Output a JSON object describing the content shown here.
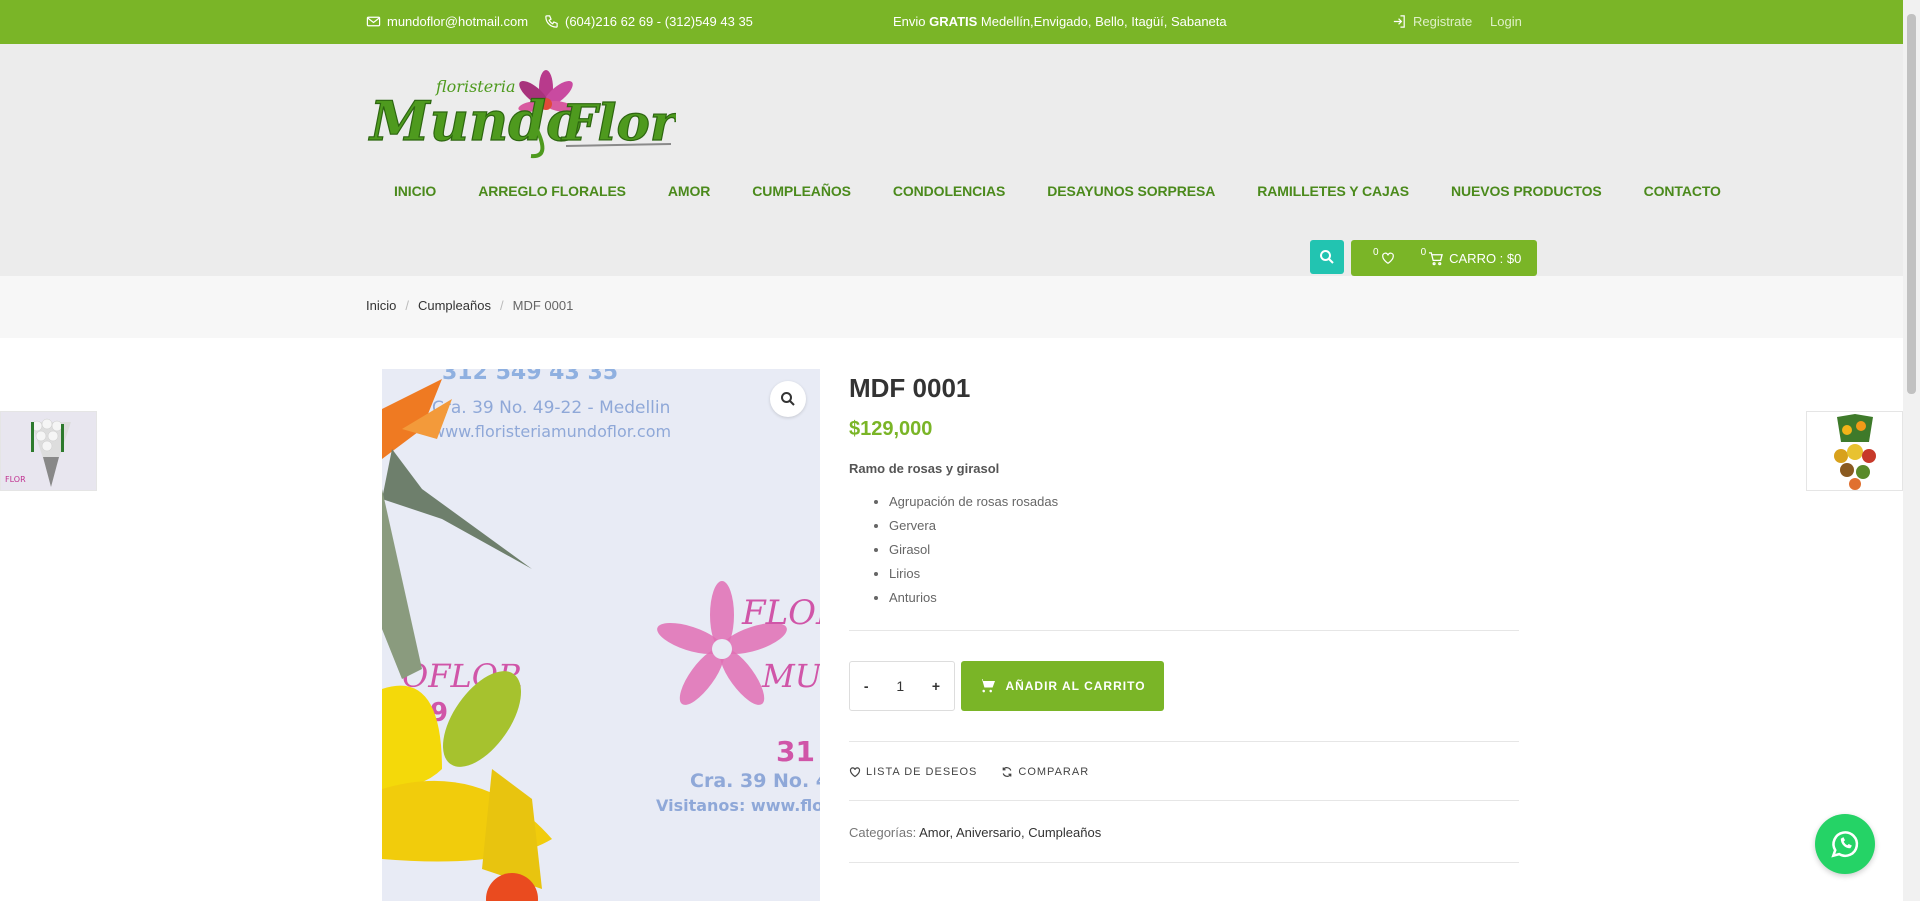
{
  "topbar": {
    "email": "mundoflor@hotmail.com",
    "phone": "(604)216 62 69 - (312)549 43 35",
    "shipping_prefix": "Envio ",
    "shipping_bold": "GRATIS",
    "shipping_rest": " Medellín,Envigado, Bello, Itagüí, Sabaneta",
    "register": "Registrate",
    "login": "Login"
  },
  "logo": {
    "small": "floristeria",
    "main": "MundoFlor"
  },
  "nav": [
    "INICIO",
    "ARREGLO FLORALES",
    "AMOR",
    "CUMPLEAÑOS",
    "CONDOLENCIAS",
    "DESAYUNOS SORPRESA",
    "RAMILLETES Y CAJAS",
    "NUEVOS PRODUCTOS",
    "CONTACTO"
  ],
  "cart": {
    "wishlist_count": "0",
    "cart_count": "0",
    "label": "CARRO : $0"
  },
  "breadcrumb": {
    "home": "Inicio",
    "category": "Cumpleaños",
    "current": "MDF 0001"
  },
  "product": {
    "title": "MDF 0001",
    "price": "$129,000",
    "description": "Ramo de rosas y girasol",
    "features": [
      "Agrupación de rosas rosadas",
      "Gervera",
      "Girasol",
      "Lirios",
      "Anturios"
    ],
    "quantity": "1",
    "minus": "-",
    "plus": "+",
    "add_to_cart": "AÑADIR AL CARRITO",
    "wishlist": "LISTA DE DESEOS",
    "compare": "COMPARAR",
    "categories_label": "Categorías: ",
    "categories": "Amor, Aniversario, Cumpleaños"
  },
  "image_text": {
    "phone": "312 549 43 35",
    "address": "Cra. 39 No. 49-22 - Medellin",
    "url": "www.floristeriamundoflor.com",
    "brand_a": "FLORIS",
    "brand_b": "OFLOR",
    "brand_c": "MU",
    "n1": "31",
    "n2": "9",
    "address2": "Cra. 39 No. 4",
    "visit": "Visitanos: www.flor"
  },
  "colors": {
    "brand_green": "#7ab527",
    "nav_green": "#4b8a1c",
    "search_teal": "#22c4b1",
    "whatsapp": "#25d366"
  },
  "icons": [
    "mail-icon",
    "phone-icon",
    "login-icon",
    "search-icon",
    "heart-icon",
    "cart-icon",
    "zoom-icon",
    "refresh-icon",
    "whatsapp-icon"
  ]
}
